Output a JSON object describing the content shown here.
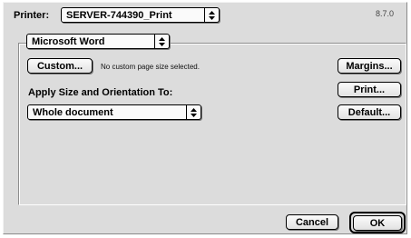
{
  "printer": {
    "label": "Printer:",
    "selected": "SERVER-744390_Print",
    "version": "8.7.0"
  },
  "app_menu": {
    "selected": "Microsoft Word"
  },
  "page_size": {
    "custom_button": "Custom...",
    "status": "No custom page size selected."
  },
  "apply": {
    "label": "Apply Size and Orientation To:",
    "selected": "Whole document"
  },
  "side_buttons": {
    "margins": "Margins...",
    "print": "Print...",
    "default": "Default..."
  },
  "footer": {
    "cancel": "Cancel",
    "ok": "OK"
  }
}
